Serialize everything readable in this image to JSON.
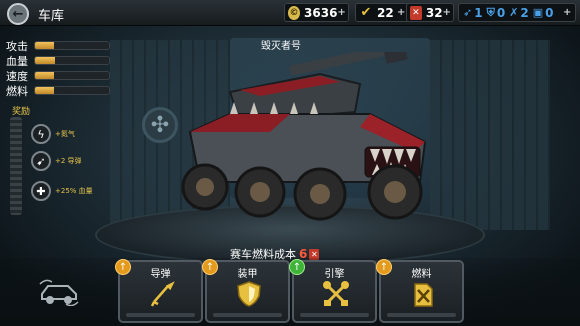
{
  "header": {
    "back_icon": "back-arrow-icon",
    "title": "车库",
    "coins": "3636",
    "gems": "22",
    "fuel": "32",
    "parts": [
      "1",
      "0",
      "2",
      "0"
    ]
  },
  "stats": [
    {
      "label": "攻击",
      "level": 0.26
    },
    {
      "label": "血量",
      "level": 0.27
    },
    {
      "label": "速度",
      "level": 0.25
    },
    {
      "label": "燃料",
      "level": 0.26
    }
  ],
  "rewards": {
    "title": "奖励",
    "items": [
      {
        "icon": "flame-icon",
        "text": "+氮气"
      },
      {
        "icon": "missile-icon",
        "text": "+2 导弹"
      },
      {
        "icon": "health-plus-icon",
        "text": "+25% 血量"
      }
    ]
  },
  "vehicle": {
    "name": "毁灭者号"
  },
  "fuel_cost": {
    "label": "赛车燃料成本",
    "value": "6"
  },
  "upgrades": [
    {
      "label": "导弹",
      "icon": "missile-icon",
      "arrow": "orange",
      "progress": 0.0
    },
    {
      "label": "装甲",
      "icon": "armor-shield-icon",
      "arrow": "orange",
      "progress": 0.0
    },
    {
      "label": "引擎",
      "icon": "engine-pistons-icon",
      "arrow": "green",
      "progress": 0.0
    },
    {
      "label": "燃料",
      "icon": "fuel-can-icon",
      "arrow": "orange",
      "progress": 0.0
    }
  ],
  "colors": {
    "accent_gold": "#e6c44a",
    "fuel_red": "#c43a2a",
    "parts_blue": "#4aa0e6",
    "upgrade_orange": "#e49a1c",
    "upgrade_green": "#3fb33a"
  }
}
